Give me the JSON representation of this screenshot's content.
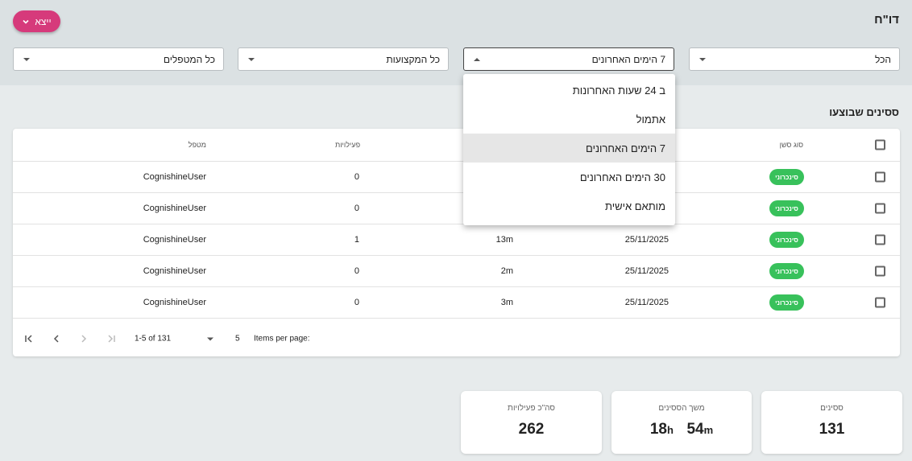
{
  "header": {
    "title": "דו\"ח",
    "export_label": "ייצא"
  },
  "filters": {
    "status": "הכל",
    "period": "7 הימים האחרונים",
    "groups": "כל המקצועות",
    "handlers": "כל המטפלים"
  },
  "period_dropdown": {
    "options": [
      "ב 24 שעות האחרונות",
      "אתמול",
      "7 הימים האחרונים",
      "30 הימים האחרונים",
      "מותאם אישית"
    ],
    "selected": "7 הימים האחרונים"
  },
  "sessions": {
    "section_title": "ססינים שבוצעו",
    "columns": {
      "type": "סוג סשן",
      "activities": "פעילויות",
      "handler": "מטפל"
    },
    "rows": [
      {
        "type": "סינכרוני",
        "date": "",
        "duration": "",
        "activities": "0",
        "handler": "CognishineUser"
      },
      {
        "type": "סינכרוני",
        "date": "",
        "duration": "",
        "activities": "0",
        "handler": "CognishineUser"
      },
      {
        "type": "סינכרוני",
        "date": "25/11/2025",
        "duration": "13m",
        "activities": "1",
        "handler": "CognishineUser"
      },
      {
        "type": "סינכרוני",
        "date": "25/11/2025",
        "duration": "2m",
        "activities": "0",
        "handler": "CognishineUser"
      },
      {
        "type": "סינכרוני",
        "date": "25/11/2025",
        "duration": "3m",
        "activities": "0",
        "handler": "CognishineUser"
      }
    ],
    "paginator": {
      "items_per_page_label": "Items per page:",
      "page_size": "5",
      "range_label": "1-5 of 131"
    }
  },
  "stats": {
    "sessions": {
      "label": "ססינים",
      "value": "131"
    },
    "duration": {
      "label": "משך הססינים",
      "hours": "18",
      "hours_unit": "h",
      "minutes": "54",
      "minutes_unit": "m"
    },
    "activities": {
      "label": "סה\"כ פעילויות",
      "value": "262"
    }
  },
  "colors": {
    "accent": "#d63a7b",
    "badge": "#38c15b",
    "topbar": "#dbe1e3",
    "background": "#e7ebec"
  }
}
